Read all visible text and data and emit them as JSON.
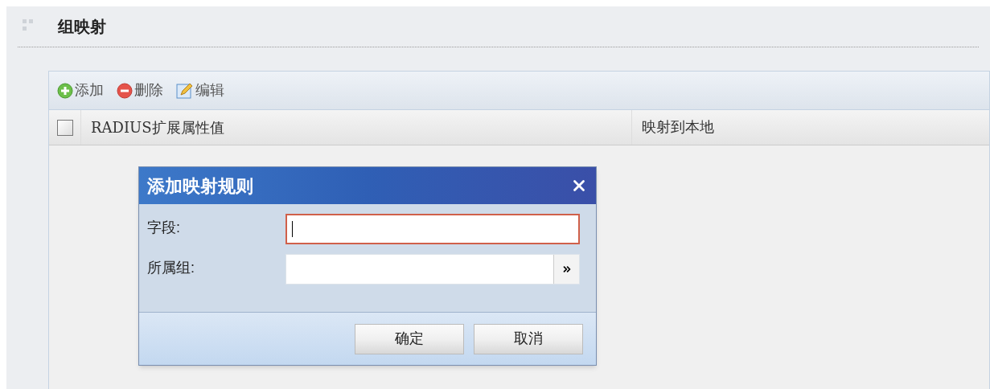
{
  "section": {
    "title": "组映射"
  },
  "toolbar": [
    {
      "kind": "add",
      "label": "添加"
    },
    {
      "kind": "delete",
      "label": "删除"
    },
    {
      "kind": "edit",
      "label": "编辑"
    }
  ],
  "table": {
    "select_all": {
      "checked": false
    },
    "columns": [
      "RADIUS扩展属性值",
      "映射到本地"
    ]
  },
  "dialog": {
    "title": "添加映射规则",
    "fields": [
      {
        "kind": "text",
        "label": "字段:",
        "focused": true
      },
      {
        "kind": "picker",
        "label": "所属组:",
        "focused": false
      }
    ],
    "buttons": [
      "确定",
      "取消"
    ]
  }
}
